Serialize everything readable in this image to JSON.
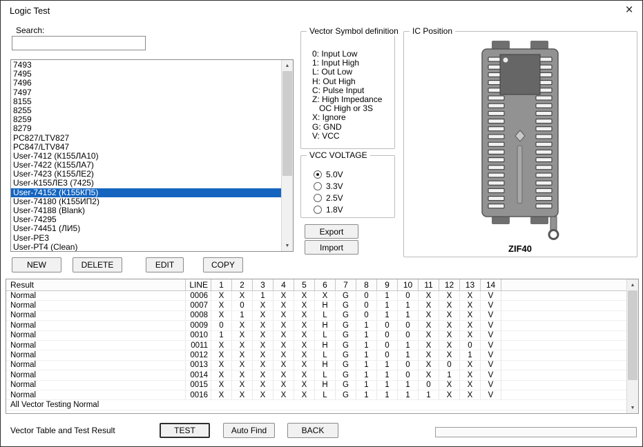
{
  "colors": {
    "selection": "#1565c0"
  },
  "window": {
    "title": "Logic Test",
    "close_glyph": "×"
  },
  "search": {
    "label": "Search:",
    "value": ""
  },
  "chip_list": {
    "selected_index": 14,
    "items": [
      "7493",
      "7495",
      "7496",
      "7497",
      "8155",
      "8255",
      "8259",
      "8279",
      "PC827/LTV827",
      "PC847/LTV847",
      "User-7412 (К155ЛА10)",
      "User-7422 (К155ЛА7)",
      "User-7423 (К155ЛЕ2)",
      "User-К155ЛЕ3 (7425)",
      "User-74152 (К155КП5)",
      "User-74180 (К155ИП2)",
      "User-74188 (Blank)",
      "User-74295",
      "User-74451 (ЛИ5)",
      "User-РЕ3",
      "User-РТ4 (Clean)"
    ]
  },
  "list_buttons": {
    "new": "NEW",
    "delete": "DELETE",
    "edit": "EDIT",
    "copy": "COPY"
  },
  "vector_symbols": {
    "title": "Vector Symbol definition",
    "lines": [
      "0: Input Low",
      "1: Input High",
      "L: Out Low",
      "H: Out High",
      "C: Pulse Input",
      "Z: High Impedance",
      "   OC High or 3S",
      "X: Ignore",
      "G: GND",
      "V: VCC"
    ]
  },
  "vcc": {
    "title": "VCC VOLTAGE",
    "options": [
      {
        "label": "5.0V",
        "selected": true
      },
      {
        "label": "3.3V",
        "selected": false
      },
      {
        "label": "2.5V",
        "selected": false
      },
      {
        "label": "1.8V",
        "selected": false
      }
    ]
  },
  "io_buttons": {
    "export": "Export",
    "import": "Import"
  },
  "ic_position": {
    "title": "IC Position",
    "socket_label": "ZIF40"
  },
  "vector_table": {
    "headers": [
      "Result",
      "LINE",
      "1",
      "2",
      "3",
      "4",
      "5",
      "6",
      "7",
      "8",
      "9",
      "10",
      "11",
      "12",
      "13",
      "14"
    ],
    "rows": [
      {
        "result": "Normal",
        "line": "0006",
        "values": [
          "X",
          "X",
          "1",
          "X",
          "X",
          "X",
          "G",
          "0",
          "1",
          "0",
          "X",
          "X",
          "X",
          "V"
        ]
      },
      {
        "result": "Normal",
        "line": "0007",
        "values": [
          "X",
          "0",
          "X",
          "X",
          "X",
          "H",
          "G",
          "0",
          "1",
          "1",
          "X",
          "X",
          "X",
          "V"
        ]
      },
      {
        "result": "Normal",
        "line": "0008",
        "values": [
          "X",
          "1",
          "X",
          "X",
          "X",
          "L",
          "G",
          "0",
          "1",
          "1",
          "X",
          "X",
          "X",
          "V"
        ]
      },
      {
        "result": "Normal",
        "line": "0009",
        "values": [
          "0",
          "X",
          "X",
          "X",
          "X",
          "H",
          "G",
          "1",
          "0",
          "0",
          "X",
          "X",
          "X",
          "V"
        ]
      },
      {
        "result": "Normal",
        "line": "0010",
        "values": [
          "1",
          "X",
          "X",
          "X",
          "X",
          "L",
          "G",
          "1",
          "0",
          "0",
          "X",
          "X",
          "X",
          "V"
        ]
      },
      {
        "result": "Normal",
        "line": "0011",
        "values": [
          "X",
          "X",
          "X",
          "X",
          "X",
          "H",
          "G",
          "1",
          "0",
          "1",
          "X",
          "X",
          "0",
          "V"
        ]
      },
      {
        "result": "Normal",
        "line": "0012",
        "values": [
          "X",
          "X",
          "X",
          "X",
          "X",
          "L",
          "G",
          "1",
          "0",
          "1",
          "X",
          "X",
          "1",
          "V"
        ]
      },
      {
        "result": "Normal",
        "line": "0013",
        "values": [
          "X",
          "X",
          "X",
          "X",
          "X",
          "H",
          "G",
          "1",
          "1",
          "0",
          "X",
          "0",
          "X",
          "V"
        ]
      },
      {
        "result": "Normal",
        "line": "0014",
        "values": [
          "X",
          "X",
          "X",
          "X",
          "X",
          "L",
          "G",
          "1",
          "1",
          "0",
          "X",
          "1",
          "X",
          "V"
        ]
      },
      {
        "result": "Normal",
        "line": "0015",
        "values": [
          "X",
          "X",
          "X",
          "X",
          "X",
          "H",
          "G",
          "1",
          "1",
          "1",
          "0",
          "X",
          "X",
          "V"
        ]
      },
      {
        "result": "Normal",
        "line": "0016",
        "values": [
          "X",
          "X",
          "X",
          "X",
          "X",
          "L",
          "G",
          "1",
          "1",
          "1",
          "1",
          "X",
          "X",
          "V"
        ]
      }
    ],
    "footer": "All Vector Testing Normal"
  },
  "bottom": {
    "status": "Vector Table and Test Result",
    "test": "TEST",
    "auto_find": "Auto Find",
    "back": "BACK"
  }
}
